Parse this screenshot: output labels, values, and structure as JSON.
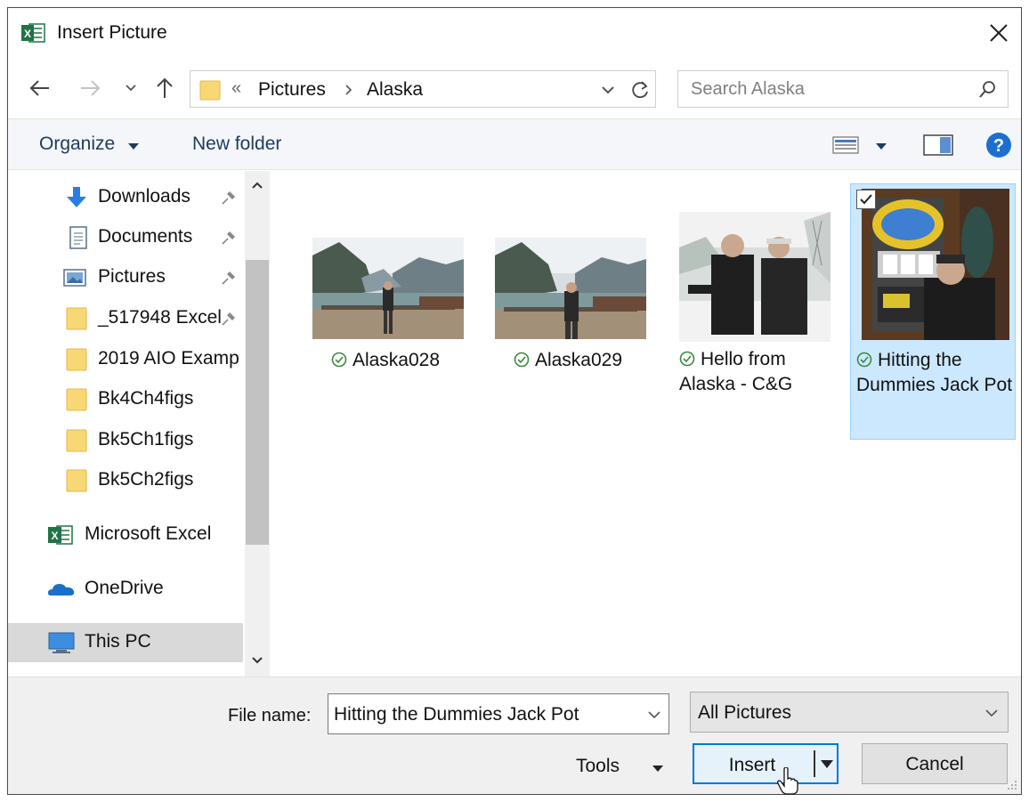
{
  "window": {
    "title": "Insert Picture",
    "app_icon": "excel-icon"
  },
  "address": {
    "crumbs": [
      "Pictures",
      "Alaska"
    ],
    "overflow": "«"
  },
  "search": {
    "placeholder": "Search Alaska"
  },
  "toolbar": {
    "organize": "Organize",
    "new_folder": "New folder"
  },
  "nav": {
    "items": [
      {
        "label": "Downloads",
        "icon": "download-arrow-icon",
        "pinned": true
      },
      {
        "label": "Documents",
        "icon": "documents-icon",
        "pinned": true
      },
      {
        "label": "Pictures",
        "icon": "pictures-icon",
        "pinned": true
      },
      {
        "label": "_517948 Excel",
        "icon": "folder-icon",
        "pinned": true
      },
      {
        "label": "2019 AIO Examp",
        "icon": "folder-icon",
        "pinned": false
      },
      {
        "label": "Bk4Ch4figs",
        "icon": "folder-icon",
        "pinned": false
      },
      {
        "label": "Bk5Ch1figs",
        "icon": "folder-icon",
        "pinned": false
      },
      {
        "label": "Bk5Ch2figs",
        "icon": "folder-icon",
        "pinned": false
      },
      {
        "label": "Microsoft Excel",
        "icon": "excel-icon",
        "pinned": false
      },
      {
        "label": "OneDrive",
        "icon": "onedrive-icon",
        "pinned": false
      },
      {
        "label": "This PC",
        "icon": "this-pc-icon",
        "pinned": false,
        "selected": true
      }
    ]
  },
  "files": [
    {
      "name": "Alaska028",
      "selected": false
    },
    {
      "name": "Alaska029",
      "selected": false
    },
    {
      "name": "Hello from Alaska - C&G",
      "selected": false
    },
    {
      "name": "Hitting the Dummies Jack Pot",
      "selected": true
    }
  ],
  "footer": {
    "file_name_label": "File name:",
    "file_name_value": "Hitting the Dummies Jack Pot",
    "file_type": "All Pictures",
    "tools": "Tools",
    "insert": "Insert",
    "cancel": "Cancel"
  },
  "colors": {
    "accent": "#0078d7",
    "selection": "#cce8ff",
    "command_text": "#1e3c60"
  }
}
